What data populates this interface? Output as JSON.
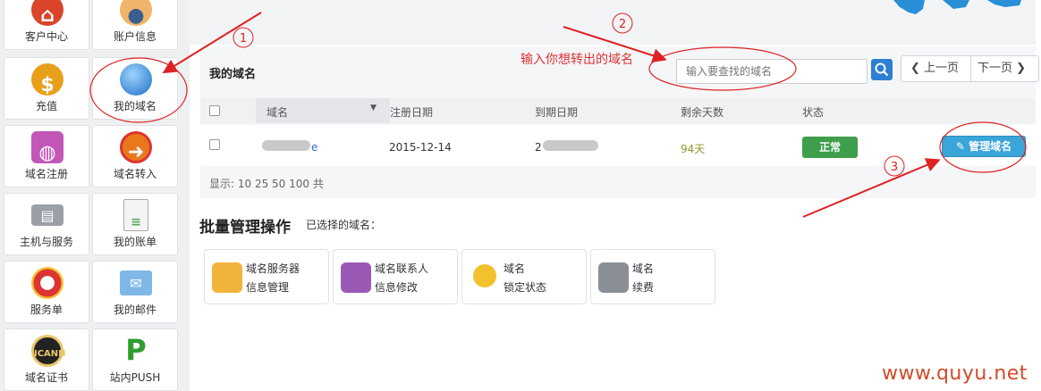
{
  "sidebar": {
    "items": [
      {
        "label": "客户中心",
        "icon": "house-icon"
      },
      {
        "label": "账户信息",
        "icon": "user-icon"
      },
      {
        "label": "充值",
        "icon": "coins-icon"
      },
      {
        "label": "我的域名",
        "icon": "globe-icon"
      },
      {
        "label": "域名注册",
        "icon": "cart-icon"
      },
      {
        "label": "域名转入",
        "icon": "transfer-icon"
      },
      {
        "label": "主机与服务",
        "icon": "server-icon"
      },
      {
        "label": "我的账单",
        "icon": "bill-icon"
      },
      {
        "label": "服务单",
        "icon": "lifebuoy-icon"
      },
      {
        "label": "我的邮件",
        "icon": "mail-icon"
      },
      {
        "label": "域名证书",
        "icon": "certificate-icon"
      },
      {
        "label": "站内PUSH",
        "icon": "push-icon"
      }
    ]
  },
  "domains": {
    "title": "我的域名",
    "search": {
      "placeholder": "输入要查找的域名"
    },
    "pager": {
      "prev": "上一页",
      "next": "下一页"
    },
    "columns": [
      "域名",
      "注册日期",
      "到期日期",
      "剩余天数",
      "状态"
    ],
    "rows": [
      {
        "domain_suffix": "e",
        "registered": "2015-12-14",
        "expiry_prefix": "2",
        "days_left": "94天",
        "status": "正常",
        "action": "管理域名"
      }
    ],
    "page_sizes": "显示: 10 25 50 100 共"
  },
  "batch": {
    "title": "批量管理操作",
    "selected_label": "已选择的域名：",
    "ops": [
      {
        "line1": "域名服务器",
        "line2": "信息管理",
        "icon": "wrench-icon"
      },
      {
        "line1": "域名联系人",
        "line2": "信息修改",
        "icon": "contact-icon"
      },
      {
        "line1": "域名",
        "line2": "锁定状态",
        "icon": "key-icon"
      },
      {
        "line1": "域名",
        "line2": "续费",
        "icon": "cart-icon"
      }
    ]
  },
  "annotations": {
    "step1": "1",
    "step2": "2",
    "step3": "3",
    "hint": "输入你想转出的域名",
    "watermark": "www.quyu.net"
  },
  "colors": {
    "accent": "#2d7fd3",
    "status_ok": "#3e9e4b",
    "manage_button": "#39a5d8",
    "annotation": "#dd2222",
    "days_left": "#8a9a2a"
  }
}
